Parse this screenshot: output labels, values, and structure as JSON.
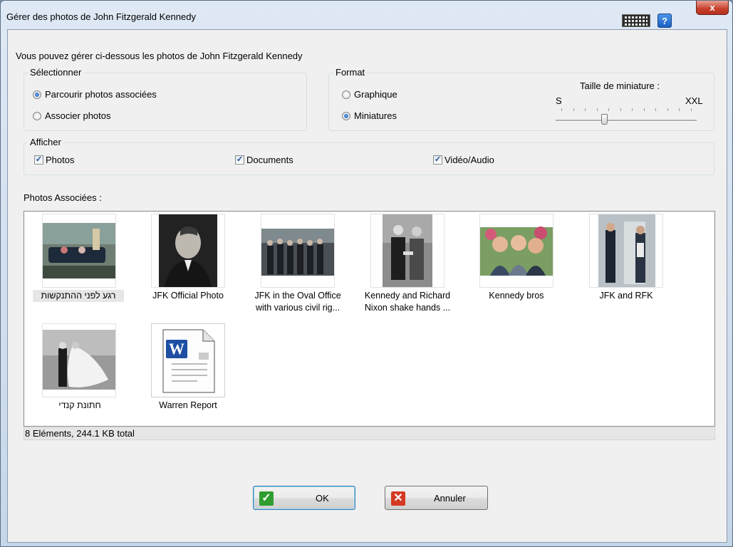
{
  "window": {
    "title": "Gérer des photos de John Fitzgerald Kennedy",
    "help_label": "?",
    "close_label": "x"
  },
  "intro": "Vous pouvez gérer ci-dessous les photos de John Fitzgerald Kennedy",
  "select_group": {
    "legend": "Sélectionner",
    "options": [
      {
        "label": "Parcourir photos associées",
        "selected": true
      },
      {
        "label": "Associer photos",
        "selected": false
      }
    ]
  },
  "format_group": {
    "legend": "Format",
    "options": [
      {
        "label": "Graphique",
        "selected": false
      },
      {
        "label": "Miniatures",
        "selected": true
      }
    ],
    "thumb_size": {
      "label": "Taille de miniature :",
      "min_label": "S",
      "max_label": "XXL",
      "level": 0.35
    }
  },
  "show_group": {
    "legend": "Afficher",
    "checks": [
      {
        "label": "Photos",
        "checked": true
      },
      {
        "label": "Documents",
        "checked": true
      },
      {
        "label": "Vidéo/Audio",
        "checked": true
      }
    ]
  },
  "photos_label": "Photos Associées :",
  "items": [
    {
      "caption": "רגע לפני ההתנקשות",
      "icon": "motorcade-photo-icon",
      "selected": true
    },
    {
      "caption": "JFK Official Photo",
      "icon": "portrait-photo-icon"
    },
    {
      "caption": "JFK in the Oval Office\nwith various civil rig...",
      "icon": "group-photo-icon"
    },
    {
      "caption": "Kennedy and Richard\nNixon shake hands ...",
      "icon": "handshake-photo-icon"
    },
    {
      "caption": "Kennedy bros",
      "icon": "brothers-photo-icon"
    },
    {
      "caption": "JFK and RFK",
      "icon": "doorway-photo-icon"
    },
    {
      "caption": "חתונת קנדי",
      "icon": "wedding-photo-icon"
    },
    {
      "caption": "Warren Report",
      "icon": "word-document-icon"
    }
  ],
  "status": "8 Eléments, 244.1 KB total",
  "buttons": {
    "ok": "OK",
    "cancel": "Annuler"
  },
  "colors": {
    "accent": "#1d5fb6",
    "ok_green": "#2f9e2f",
    "cancel_red": "#d43a22"
  }
}
